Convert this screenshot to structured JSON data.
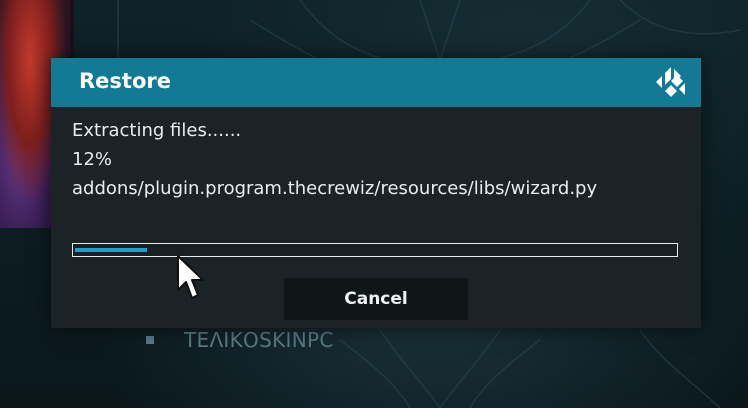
{
  "background": {
    "list_item_label": "ΤΕΛΙΚΟSKINPC"
  },
  "dialog": {
    "title": "Restore",
    "logo_icon": "kodi-logo-icon",
    "status_line": "Extracting files......",
    "percent_text": "12%",
    "file_path": "addons/plugin.program.thecrewiz/resources/libs/wizard.py",
    "progress": 0.12,
    "cancel_label": "Cancel"
  },
  "colors": {
    "header_accent": "#137a95",
    "progress_fill": "#1aa3c9",
    "dialog_bg": "#1b2326",
    "button_bg": "#101618"
  }
}
